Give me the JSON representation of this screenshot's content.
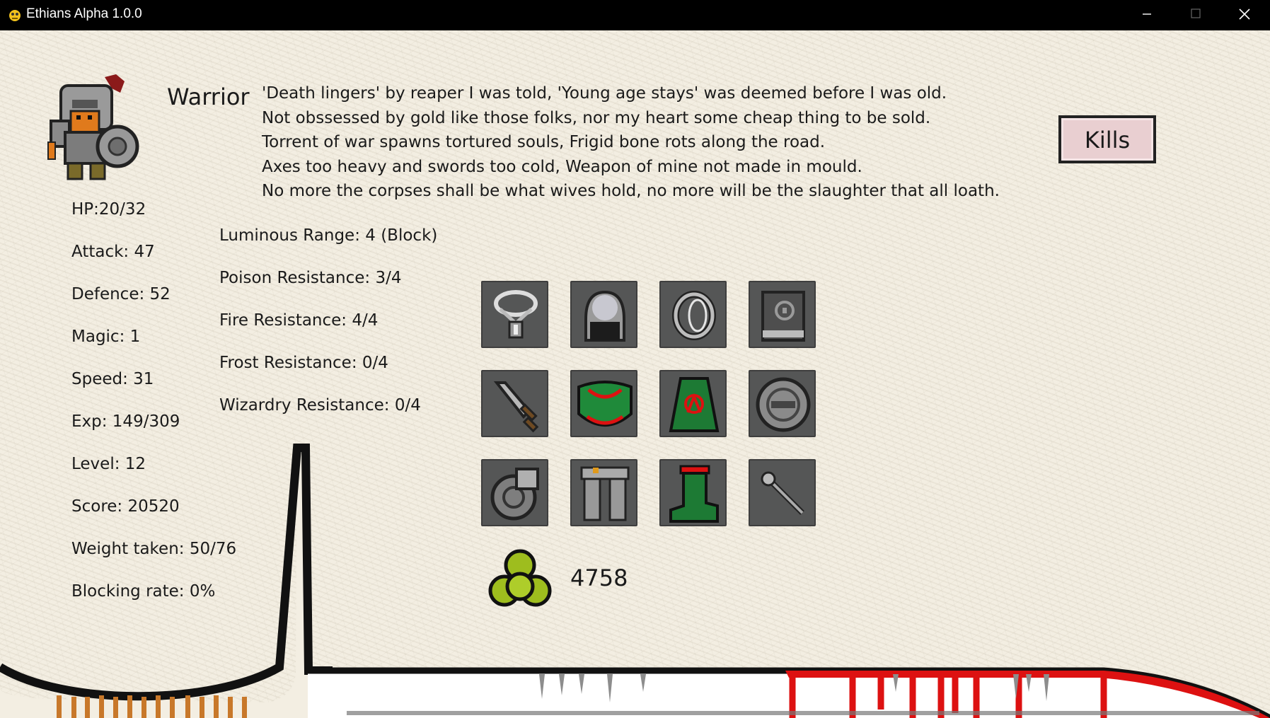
{
  "window": {
    "title": "Ethians Alpha 1.0.0",
    "icon": "pygame-snake-icon"
  },
  "character": {
    "class_name": "Warrior",
    "portrait": "warrior-knight-sprite",
    "lore": [
      "'Death lingers' by reaper I was told, 'Young age stays' was deemed before I was old.",
      "Not obssessed by gold like those folks, nor my heart some cheap thing to be sold.",
      "Torrent of war spawns tortured souls, Frigid bone rots along the road.",
      "Axes too heavy and swords too cold, Weapon of mine not made in mould.",
      "No more the corpses shall be what wives hold, no more will be the slaughter that all loath."
    ]
  },
  "kills_button": {
    "label": "Kills"
  },
  "stats": [
    "HP:20/32",
    "Attack: 47",
    "Defence: 52",
    "Magic: 1",
    "Speed: 31",
    "Exp: 149/309",
    "Level: 12",
    "Score: 20520",
    "Weight taken: 50/76",
    "Blocking rate: 0%"
  ],
  "resistances": [
    "Luminous Range: 4 (Block)",
    "Poison Resistance: 3/4",
    "Fire Resistance: 4/4",
    "Frost Resistance: 0/4",
    "Wizardry Resistance: 0/4"
  ],
  "equipment": [
    [
      "amulet-icon",
      "helmet-icon",
      "ring-icon",
      "spellbook-icon"
    ],
    [
      "sword-icon",
      "green-chestplate-icon",
      "green-cloak-icon",
      "round-shield-icon"
    ],
    [
      "gauntlet-icon",
      "leg-armor-icon",
      "green-boots-icon",
      "wand-icon"
    ]
  ],
  "gold": {
    "icon": "gold-pile-icon",
    "amount": "4758"
  },
  "colors": {
    "slot_bg": "#555656",
    "kills_bg": "#e9cfd1",
    "blood": "#dd1111",
    "gold": "#9ebd1e"
  }
}
